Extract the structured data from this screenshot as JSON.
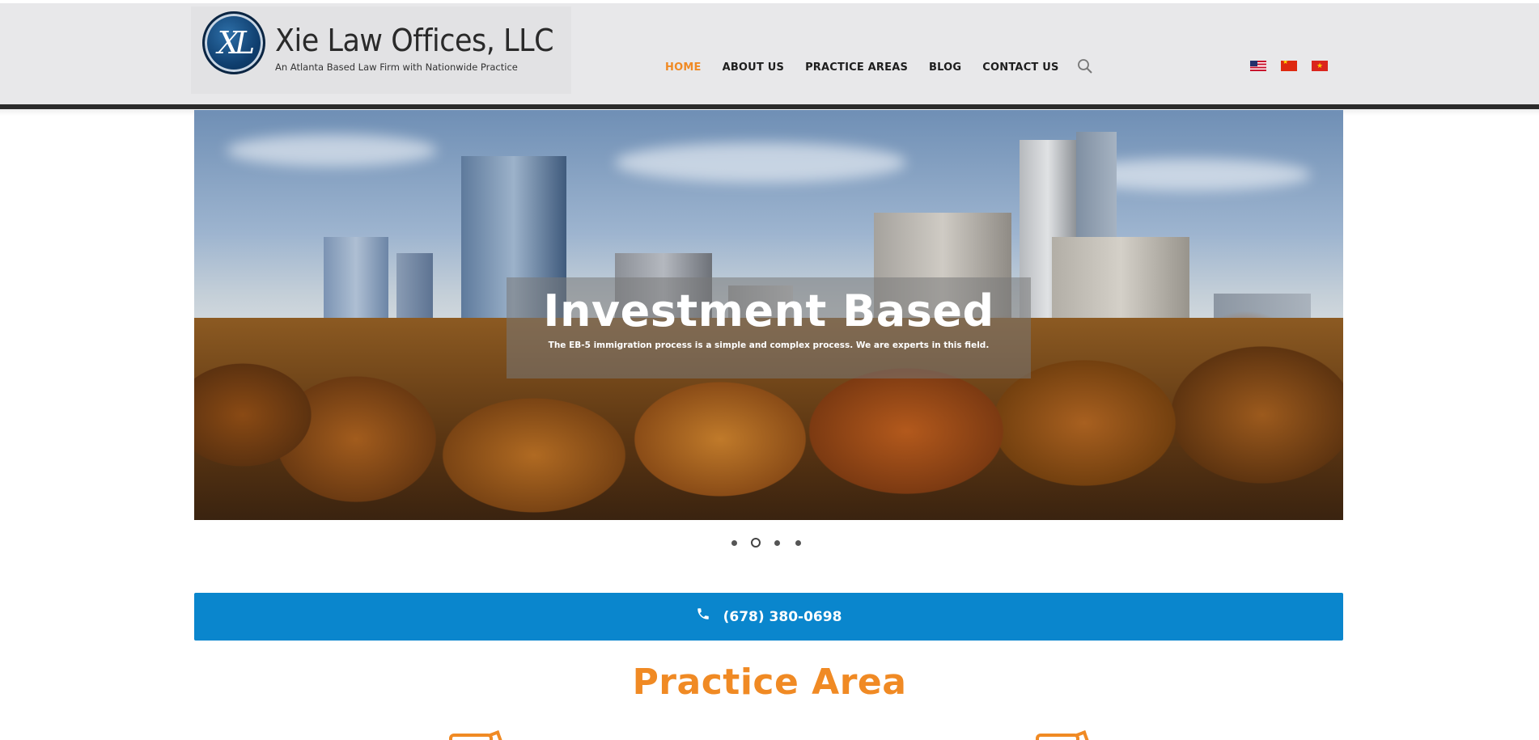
{
  "header": {
    "logo": {
      "emblem_text": "XL",
      "title": "Xie Law Offices, LLC",
      "tagline": "An Atlanta Based Law Firm with Nationwide Practice"
    },
    "nav": [
      {
        "label": "HOME",
        "active": true
      },
      {
        "label": "ABOUT US",
        "active": false
      },
      {
        "label": "PRACTICE AREAS",
        "active": false
      },
      {
        "label": "BLOG",
        "active": false
      },
      {
        "label": "CONTACT US",
        "active": false
      }
    ],
    "search_icon": "search-icon",
    "languages": [
      "us-flag-icon",
      "china-flag-icon",
      "vietnam-flag-icon"
    ]
  },
  "hero": {
    "title": "Investment Based",
    "subtitle": "The EB-5 immigration process is a simple and complex process. We are experts in this field.",
    "slide_count": 4,
    "active_slide": 2
  },
  "contact": {
    "phone_icon": "phone-icon",
    "phone": "(678) 380-0698"
  },
  "section": {
    "title": "Practice Area"
  },
  "colors": {
    "accent": "#f08a24",
    "phone_bar": "#0a86cd",
    "header_bg": "#e8e8ea",
    "header_bar": "#2b2b2b"
  }
}
